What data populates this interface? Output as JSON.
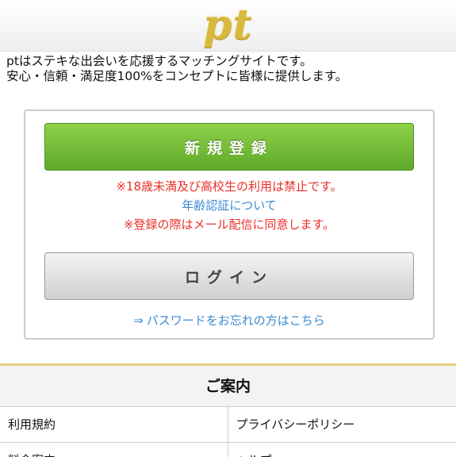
{
  "header": {
    "logo_text": "pt"
  },
  "intro": {
    "line1": "ptはステキな出会いを応援するマッチングサイトです。",
    "line2": "安心・信頼・満足度100%をコンセプトに皆様に提供します。"
  },
  "auth": {
    "register_label": "新規登録",
    "notice_age": "※18歳未満及び高校生の利用は禁止です。",
    "age_verification_link": "年齢認証について",
    "notice_mail": "※登録の際はメール配信に同意します。",
    "login_label": "ログイン",
    "forgot_arrow": "⇒",
    "forgot_link": "パスワードをお忘れの方はこちら"
  },
  "guide": {
    "title": "ご案内",
    "links": [
      [
        "利用規約",
        "プライバシーポリシー"
      ],
      [
        "料金案内",
        "ヘルプ"
      ]
    ]
  },
  "colors": {
    "logo_gold": "#d9b93c",
    "register_green": "#6cba34",
    "notice_red": "#e8302a",
    "link_blue": "#3a8bd0",
    "divider_gold": "#e3cf7a"
  }
}
